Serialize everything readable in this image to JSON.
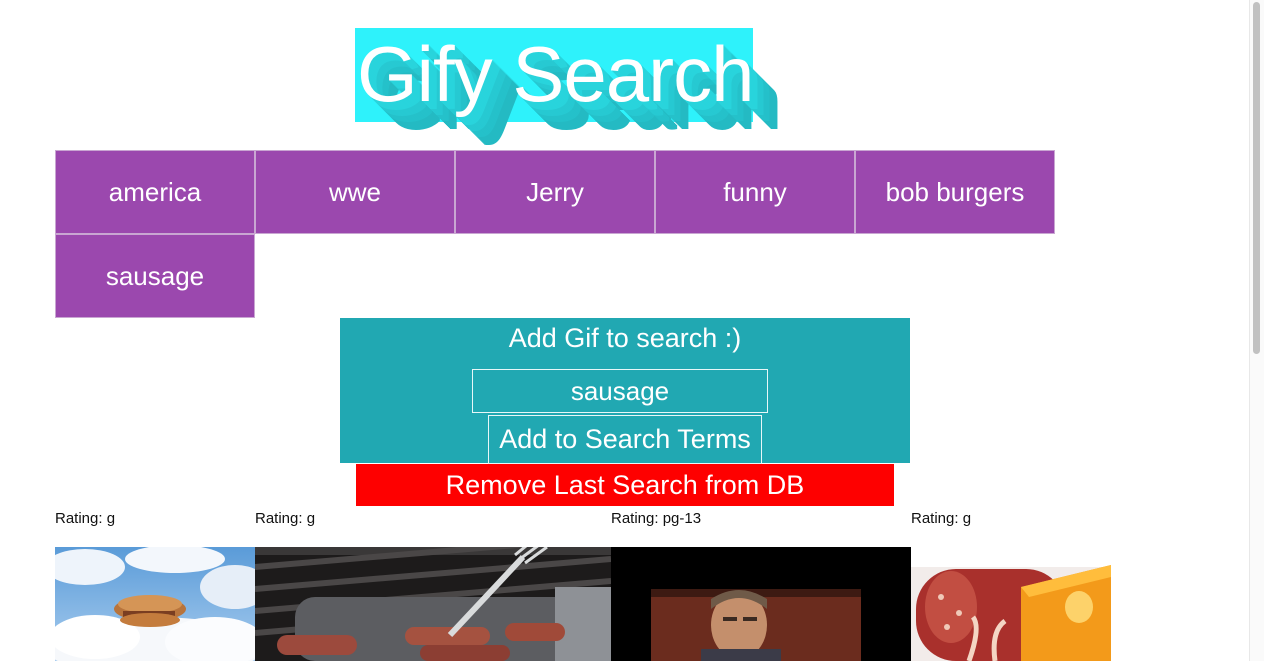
{
  "header": {
    "title": "Gify Search"
  },
  "topics": [
    "america",
    "wwe",
    "Jerry",
    "funny",
    "bob burgers",
    "sausage"
  ],
  "form": {
    "title": "Add Gif to search :)",
    "input_value": "sausage",
    "add_label": "Add to Search Terms",
    "remove_label": "Remove Last Search from DB"
  },
  "gifs": [
    {
      "rating": "Rating: g"
    },
    {
      "rating": "Rating: g"
    },
    {
      "rating": "Rating: pg-13"
    },
    {
      "rating": "Rating: g"
    }
  ],
  "colors": {
    "title_bg": "#2ef2fb",
    "topic_bg": "#9b48ae",
    "form_bg": "#21a8b2",
    "remove_bg": "#fe0000"
  }
}
